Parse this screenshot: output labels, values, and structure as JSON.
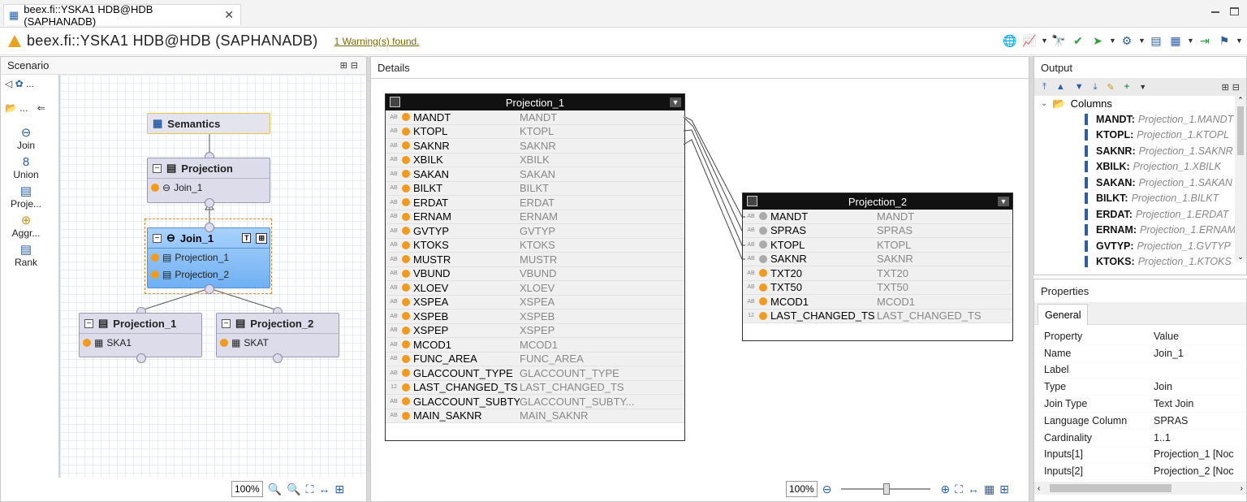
{
  "tab": {
    "title": "beex.fi::YSKA1 HDB@HDB (SAPHANADB)",
    "close": "✕"
  },
  "header": {
    "title": "beex.fi::YSKA1 HDB@HDB (SAPHANADB)",
    "warning_link": "1 Warning(s) found."
  },
  "scenario": {
    "title": "Scenario",
    "palette": [
      {
        "label": "Join",
        "icon": "join-icon"
      },
      {
        "label": "Union",
        "icon": "union-icon"
      },
      {
        "label": "Proje...",
        "icon": "projection-icon"
      },
      {
        "label": "Aggr...",
        "icon": "aggregation-icon"
      },
      {
        "label": "Rank",
        "icon": "rank-icon"
      }
    ],
    "nodes": {
      "semantics": {
        "label": "Semantics"
      },
      "projection": {
        "label": "Projection",
        "input": "Join_1"
      },
      "join": {
        "label": "Join_1",
        "inputs": [
          "Projection_1",
          "Projection_2"
        ]
      },
      "projection_1": {
        "label": "Projection_1",
        "input": "SKA1"
      },
      "projection_2": {
        "label": "Projection_2",
        "input": "SKAT"
      }
    },
    "zoom": "100%"
  },
  "details": {
    "title": "Details",
    "zoom": "100%",
    "projection_1": {
      "title": "Projection_1",
      "rows": [
        {
          "type": "AB",
          "name": "MANDT",
          "source": "MANDT"
        },
        {
          "type": "AB",
          "name": "KTOPL",
          "source": "KTOPL"
        },
        {
          "type": "AB",
          "name": "SAKNR",
          "source": "SAKNR"
        },
        {
          "type": "AB",
          "name": "XBILK",
          "source": "XBILK"
        },
        {
          "type": "AB",
          "name": "SAKAN",
          "source": "SAKAN"
        },
        {
          "type": "AB",
          "name": "BILKT",
          "source": "BILKT"
        },
        {
          "type": "AB",
          "name": "ERDAT",
          "source": "ERDAT"
        },
        {
          "type": "AB",
          "name": "ERNAM",
          "source": "ERNAM"
        },
        {
          "type": "AB",
          "name": "GVTYP",
          "source": "GVTYP"
        },
        {
          "type": "AB",
          "name": "KTOKS",
          "source": "KTOKS"
        },
        {
          "type": "AB",
          "name": "MUSTR",
          "source": "MUSTR"
        },
        {
          "type": "AB",
          "name": "VBUND",
          "source": "VBUND"
        },
        {
          "type": "AB",
          "name": "XLOEV",
          "source": "XLOEV"
        },
        {
          "type": "AB",
          "name": "XSPEA",
          "source": "XSPEA"
        },
        {
          "type": "AB",
          "name": "XSPEB",
          "source": "XSPEB"
        },
        {
          "type": "AB",
          "name": "XSPEP",
          "source": "XSPEP"
        },
        {
          "type": "AB",
          "name": "MCOD1",
          "source": "MCOD1"
        },
        {
          "type": "AB",
          "name": "FUNC_AREA",
          "source": "FUNC_AREA"
        },
        {
          "type": "AB",
          "name": "GLACCOUNT_TYPE",
          "source": "GLACCOUNT_TYPE"
        },
        {
          "type": "12",
          "name": "LAST_CHANGED_TS",
          "source": "LAST_CHANGED_TS"
        },
        {
          "type": "AB",
          "name": "GLACCOUNT_SUBTYPE",
          "source": "GLACCOUNT_SUBTY..."
        },
        {
          "type": "AB",
          "name": "MAIN_SAKNR",
          "source": "MAIN_SAKNR"
        }
      ]
    },
    "projection_2": {
      "title": "Projection_2",
      "rows": [
        {
          "type": "AB",
          "name": "MANDT",
          "source": "MANDT",
          "marker": "grey"
        },
        {
          "type": "AB",
          "name": "SPRAS",
          "source": "SPRAS",
          "marker": "grey"
        },
        {
          "type": "AB",
          "name": "KTOPL",
          "source": "KTOPL",
          "marker": "grey"
        },
        {
          "type": "AB",
          "name": "SAKNR",
          "source": "SAKNR",
          "marker": "grey"
        },
        {
          "type": "AB",
          "name": "TXT20",
          "source": "TXT20",
          "marker": "orange"
        },
        {
          "type": "AB",
          "name": "TXT50",
          "source": "TXT50",
          "marker": "orange"
        },
        {
          "type": "AB",
          "name": "MCOD1",
          "source": "MCOD1",
          "marker": "orange"
        },
        {
          "type": "12",
          "name": "LAST_CHANGED_TS",
          "source": "LAST_CHANGED_TS",
          "marker": "orange"
        }
      ]
    }
  },
  "output": {
    "title": "Output",
    "folder": "Columns",
    "columns": [
      {
        "name": "MANDT:",
        "source": "Projection_1.MANDT"
      },
      {
        "name": "KTOPL:",
        "source": "Projection_1.KTOPL"
      },
      {
        "name": "SAKNR:",
        "source": "Projection_1.SAKNR"
      },
      {
        "name": "XBILK:",
        "source": "Projection_1.XBILK"
      },
      {
        "name": "SAKAN:",
        "source": "Projection_1.SAKAN"
      },
      {
        "name": "BILKT:",
        "source": "Projection_1.BILKT"
      },
      {
        "name": "ERDAT:",
        "source": "Projection_1.ERDAT"
      },
      {
        "name": "ERNAM:",
        "source": "Projection_1.ERNAM"
      },
      {
        "name": "GVTYP:",
        "source": "Projection_1.GVTYP"
      },
      {
        "name": "KTOKS:",
        "source": "Projection_1.KTOKS"
      }
    ]
  },
  "properties": {
    "title": "Properties",
    "tab": "General",
    "header": {
      "key": "Property",
      "value": "Value"
    },
    "rows": [
      {
        "key": "Name",
        "value": "Join_1"
      },
      {
        "key": "Label",
        "value": ""
      },
      {
        "key": "Type",
        "value": "Join"
      },
      {
        "key": "Join Type",
        "value": "Text Join"
      },
      {
        "key": "Language Column",
        "value": "SPRAS"
      },
      {
        "key": "Cardinality",
        "value": "1..1"
      },
      {
        "key": "Inputs[1]",
        "value": "Projection_1 [Noc"
      },
      {
        "key": "Inputs[2]",
        "value": "Projection_2 [Noc"
      }
    ]
  },
  "colors": {
    "accent": "#2a5fa8",
    "warning": "#e8a317",
    "column_marker": "#f29a1c"
  }
}
